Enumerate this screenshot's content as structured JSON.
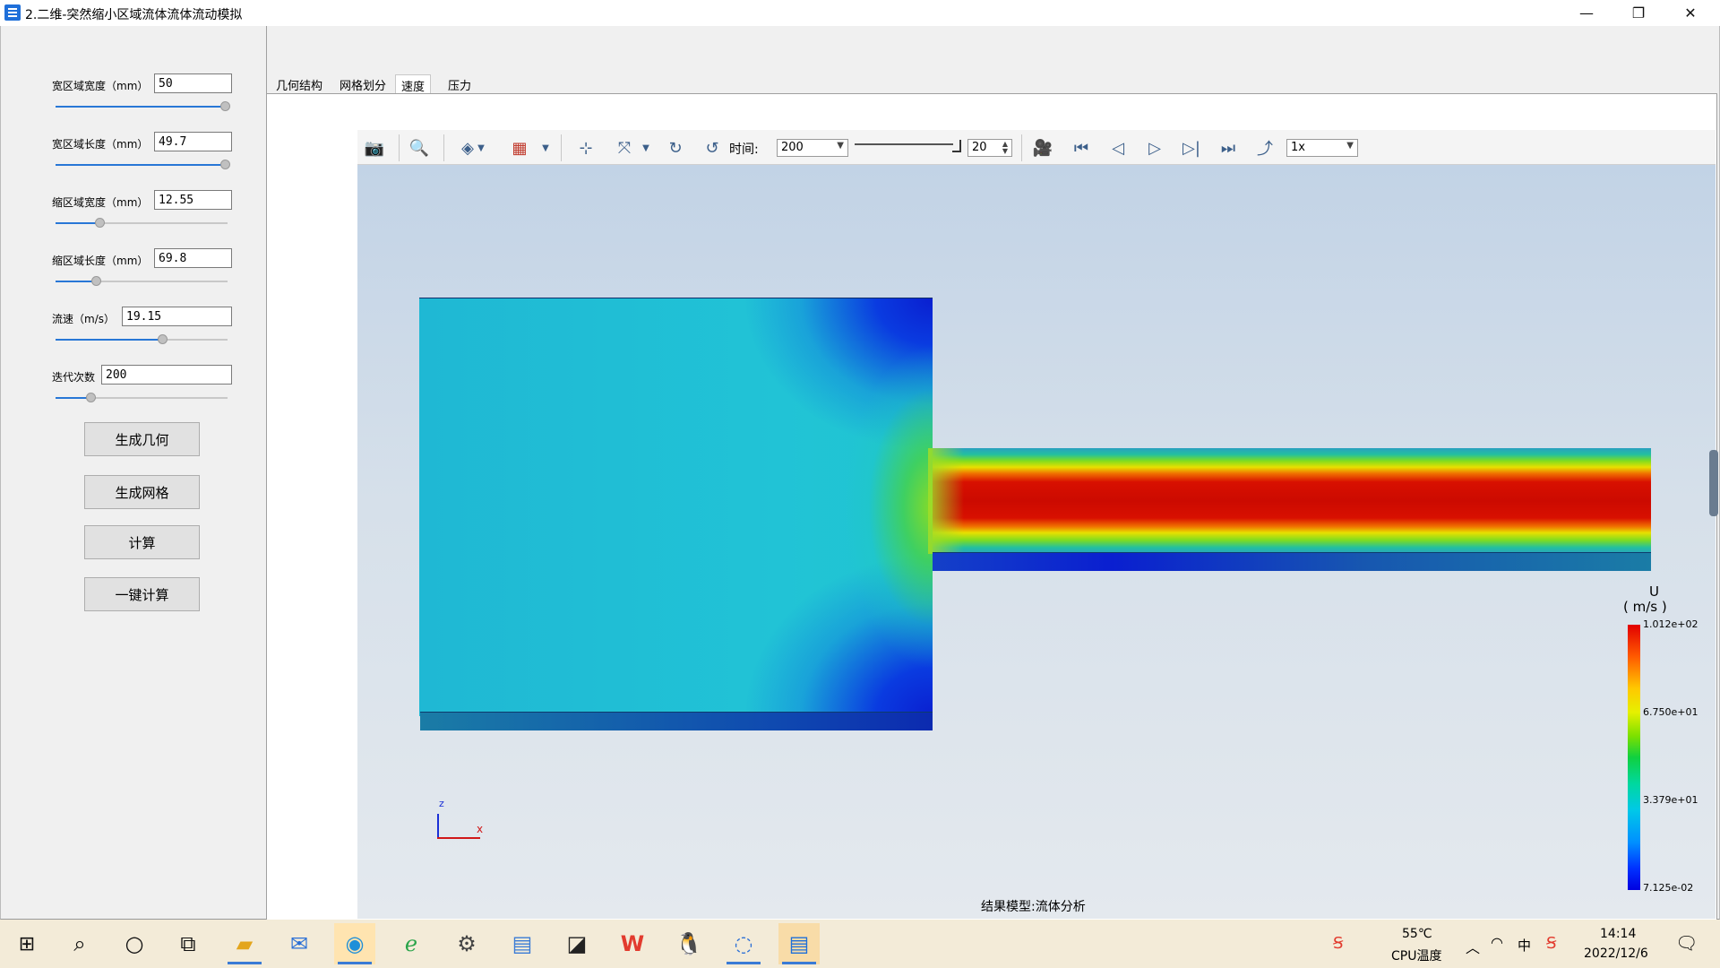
{
  "window": {
    "title": "2.二维-突然缩小区域流体流体流动模拟",
    "controls": [
      "—",
      "❐",
      "✕"
    ]
  },
  "params": [
    {
      "label": "宽区域宽度（mm）",
      "value": "50"
    },
    {
      "label": "宽区域长度（mm）",
      "value": "49.7"
    },
    {
      "label": "缩区域宽度（mm）",
      "value": "12.55"
    },
    {
      "label": "缩区域长度（mm）",
      "value": "69.8"
    },
    {
      "label": "流速（m/s）",
      "value": "19.15"
    },
    {
      "label": "迭代次数",
      "value": "200"
    }
  ],
  "buttons": {
    "gen_geometry": "生成几何",
    "gen_mesh": "生成网格",
    "compute": "计算",
    "one_click": "一键计算"
  },
  "tabs": [
    "几何结构",
    "网格划分",
    "速度",
    "压力"
  ],
  "active_tab": "速度",
  "toolbar": {
    "time_label": "时间:",
    "time_value": "200",
    "step_value": "20",
    "speed_value": "1x"
  },
  "legend": {
    "title_line1": "U",
    "title_line2": "( m/s )",
    "max": "1.012e+02",
    "mid_high": "6.750e+01",
    "mid_low": "3.379e+01",
    "min": "7.125e-02"
  },
  "axes": {
    "z": "z",
    "x": "x"
  },
  "status": {
    "model_label": "结果模型:流体分析"
  },
  "taskbar": {
    "temp": "55℃",
    "temp_label": "CPU温度",
    "time": "14:14",
    "date": "2022/12/6",
    "ime": "中"
  },
  "colors": {
    "accent": "#2877d6",
    "high": "#d40000",
    "low": "#0a1fd0",
    "mid": "#21c3d6"
  }
}
